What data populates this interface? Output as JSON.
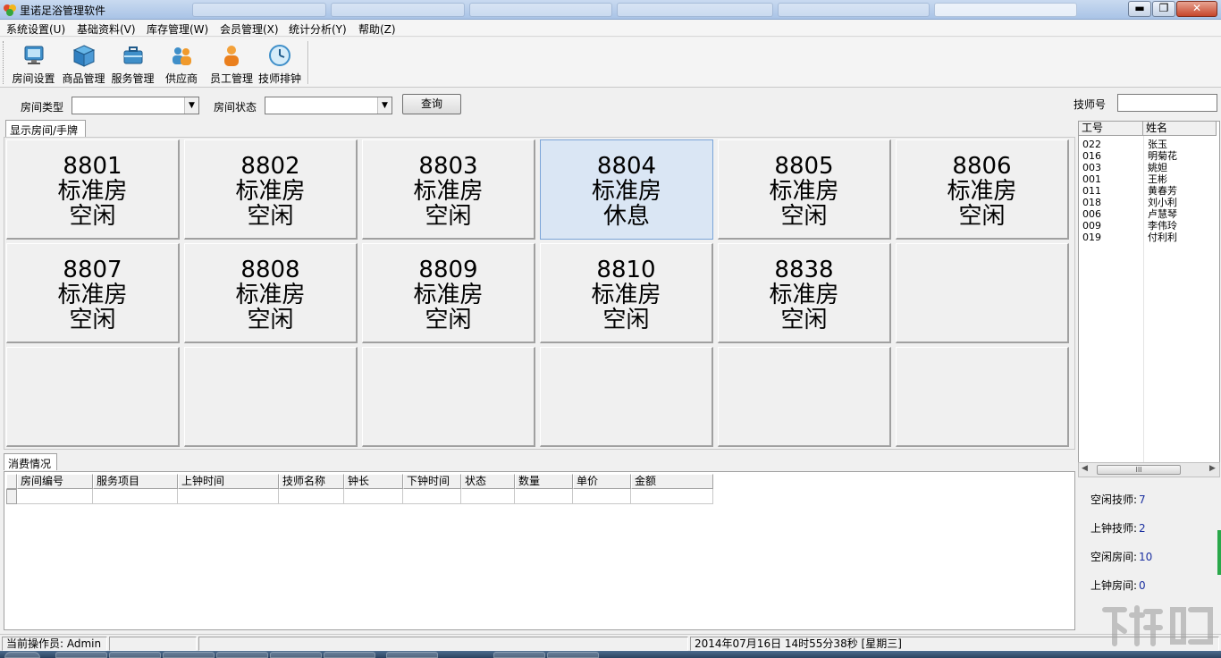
{
  "window": {
    "title": "里诺足浴管理软件",
    "minimize_glyph": "▬",
    "maximize_glyph": "❐",
    "close_glyph": "✕"
  },
  "menu": [
    {
      "label": "系统设置(U)"
    },
    {
      "label": "基础资料(V)"
    },
    {
      "label": "库存管理(W)"
    },
    {
      "label": "会员管理(X)"
    },
    {
      "label": "统计分析(Y)"
    },
    {
      "label": "帮助(Z)"
    }
  ],
  "toolbar": [
    {
      "label": "房间设置",
      "icon": "monitor-icon"
    },
    {
      "label": "商品管理",
      "icon": "box-icon"
    },
    {
      "label": "服务管理",
      "icon": "briefcase-icon"
    },
    {
      "label": "供应商",
      "icon": "users-icon"
    },
    {
      "label": "员工管理",
      "icon": "person-icon"
    },
    {
      "label": "技师排钟",
      "icon": "clock-icon"
    }
  ],
  "filters": {
    "room_type_label": "房间类型",
    "room_type_value": "",
    "room_status_label": "房间状态",
    "room_status_value": "",
    "query_button": "查询",
    "tech_no_label": "技师号",
    "tech_no_value": ""
  },
  "rooms_tab": "显示房间/手牌",
  "rooms": [
    {
      "number": "8801",
      "type": "标准房",
      "status": "空闲",
      "selected": false
    },
    {
      "number": "8802",
      "type": "标准房",
      "status": "空闲",
      "selected": false
    },
    {
      "number": "8803",
      "type": "标准房",
      "status": "空闲",
      "selected": false
    },
    {
      "number": "8804",
      "type": "标准房",
      "status": "休息",
      "selected": true
    },
    {
      "number": "8805",
      "type": "标准房",
      "status": "空闲",
      "selected": false
    },
    {
      "number": "8806",
      "type": "标准房",
      "status": "空闲",
      "selected": false
    },
    {
      "number": "8807",
      "type": "标准房",
      "status": "空闲",
      "selected": false
    },
    {
      "number": "8808",
      "type": "标准房",
      "status": "空闲",
      "selected": false
    },
    {
      "number": "8809",
      "type": "标准房",
      "status": "空闲",
      "selected": false
    },
    {
      "number": "8810",
      "type": "标准房",
      "status": "空闲",
      "selected": false
    },
    {
      "number": "8838",
      "type": "标准房",
      "status": "空闲",
      "selected": false
    }
  ],
  "consumption": {
    "tab": "消费情况",
    "columns": [
      "房间编号",
      "服务项目",
      "上钟时间",
      "技师名称",
      "钟长",
      "下钟时间",
      "状态",
      "数量",
      "单价",
      "金额"
    ]
  },
  "technicians": {
    "columns": [
      "工号",
      "姓名"
    ],
    "rows": [
      {
        "id": "022",
        "name": "张玉"
      },
      {
        "id": "016",
        "name": "明菊花"
      },
      {
        "id": "003",
        "name": "姚妲"
      },
      {
        "id": "001",
        "name": "王彬"
      },
      {
        "id": "011",
        "name": "黄春芳"
      },
      {
        "id": "018",
        "name": "刘小利"
      },
      {
        "id": "006",
        "name": "卢慧琴"
      },
      {
        "id": "009",
        "name": "李伟玲"
      },
      {
        "id": "019",
        "name": "付利利"
      }
    ],
    "scroll_thumb_glyph": "III"
  },
  "stats": [
    {
      "label": "空闲技师:",
      "value": "7"
    },
    {
      "label": "上钟技师:",
      "value": "2"
    },
    {
      "label": "空闲房间:",
      "value": "10"
    },
    {
      "label": "上钟房间:",
      "value": "0"
    }
  ],
  "status": {
    "operator": "当前操作员: Admin",
    "datetime": "2014年07月16日 14时55分38秒  [星期三]"
  },
  "colors": {
    "selected_room": "#dae6f4",
    "stat_value": "#1a2fa0"
  }
}
